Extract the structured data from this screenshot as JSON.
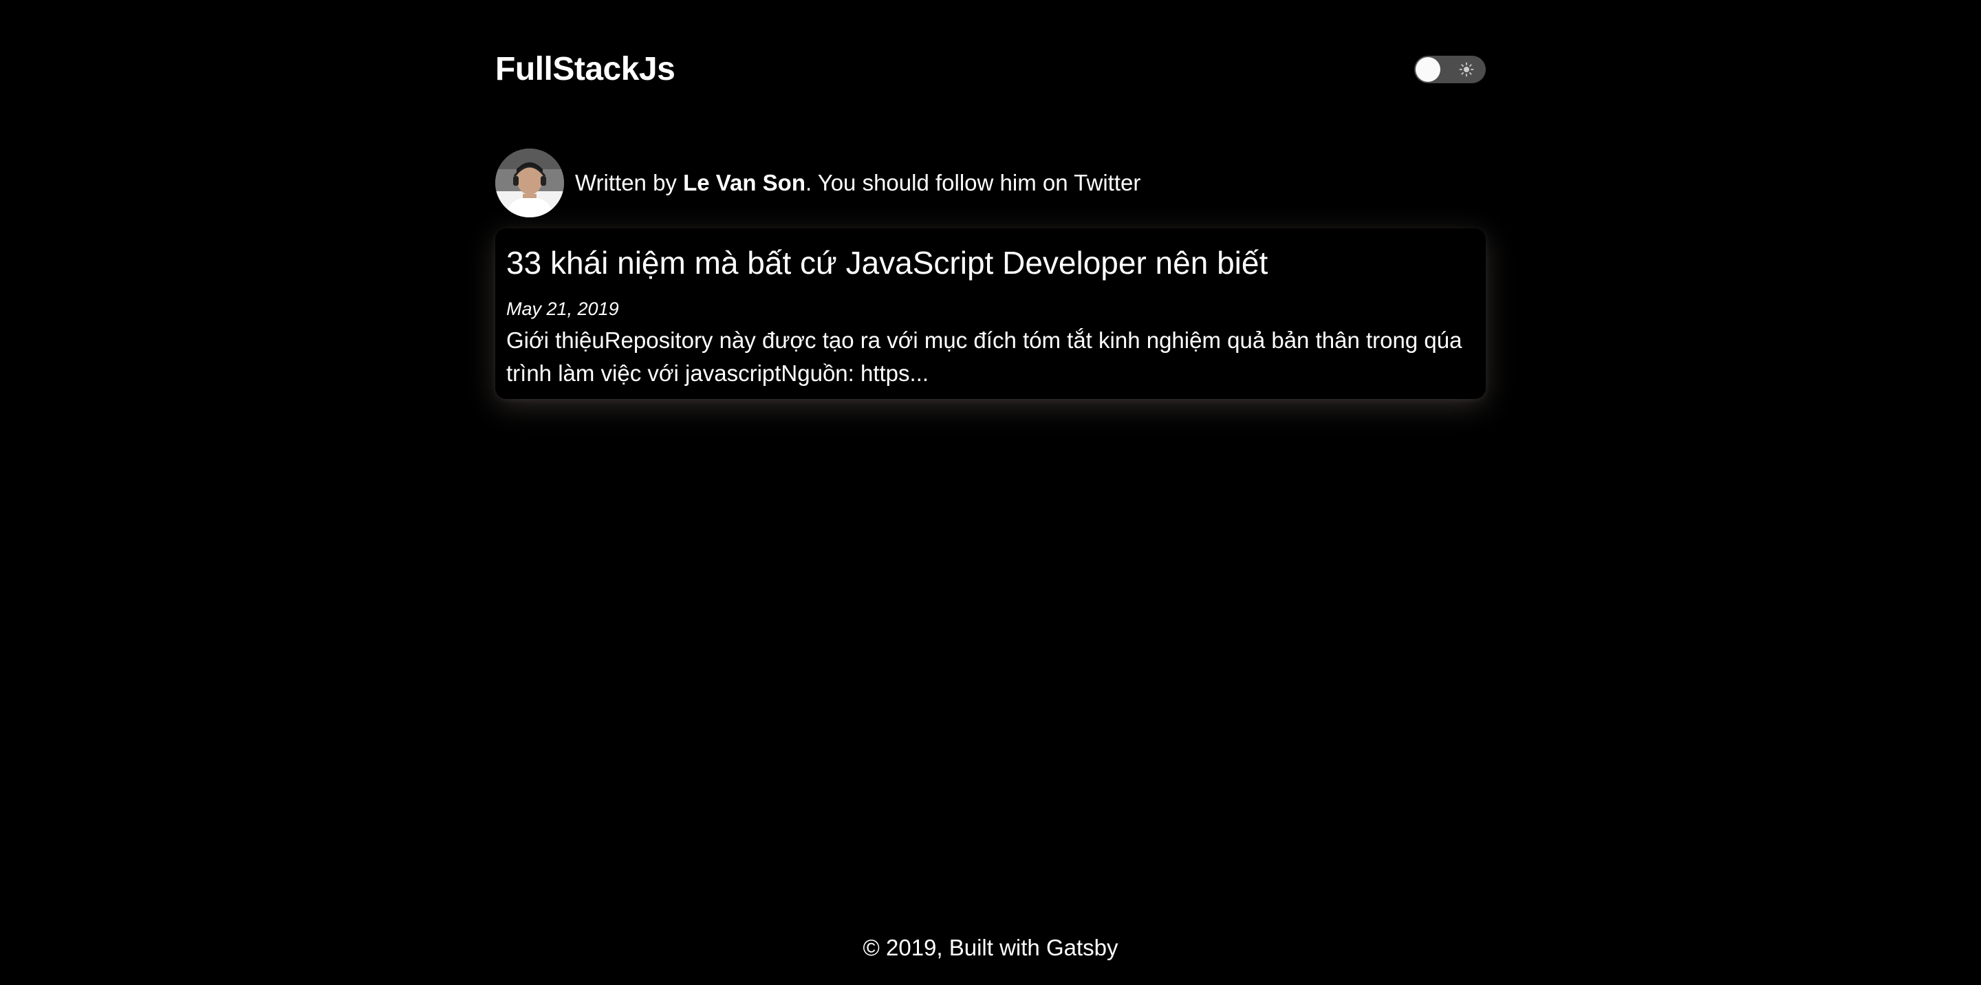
{
  "header": {
    "site_title": "FullStackJs",
    "theme_toggle": {
      "state": "dark",
      "icon": "sun-icon"
    }
  },
  "bio": {
    "prefix": "Written by ",
    "author": "Le Van Son",
    "suffix": ". You should follow him on Twitter",
    "avatar_icon": "author-avatar"
  },
  "posts": [
    {
      "title": "33 khái niệm mà bất cứ JavaScript Developer nên biết",
      "date": "May 21, 2019",
      "excerpt": "Giới thiệuRepository này được tạo ra với mục đích tóm tắt kinh nghiệm quả bản thân trong qúa trình làm việc với javascriptNguồn: https..."
    }
  ],
  "footer": {
    "text": "© 2019, Built with Gatsby"
  },
  "colors": {
    "background": "#000000",
    "text": "#ffffff",
    "toggle_track": "#4d4d4d",
    "toggle_thumb": "#fafafa"
  }
}
